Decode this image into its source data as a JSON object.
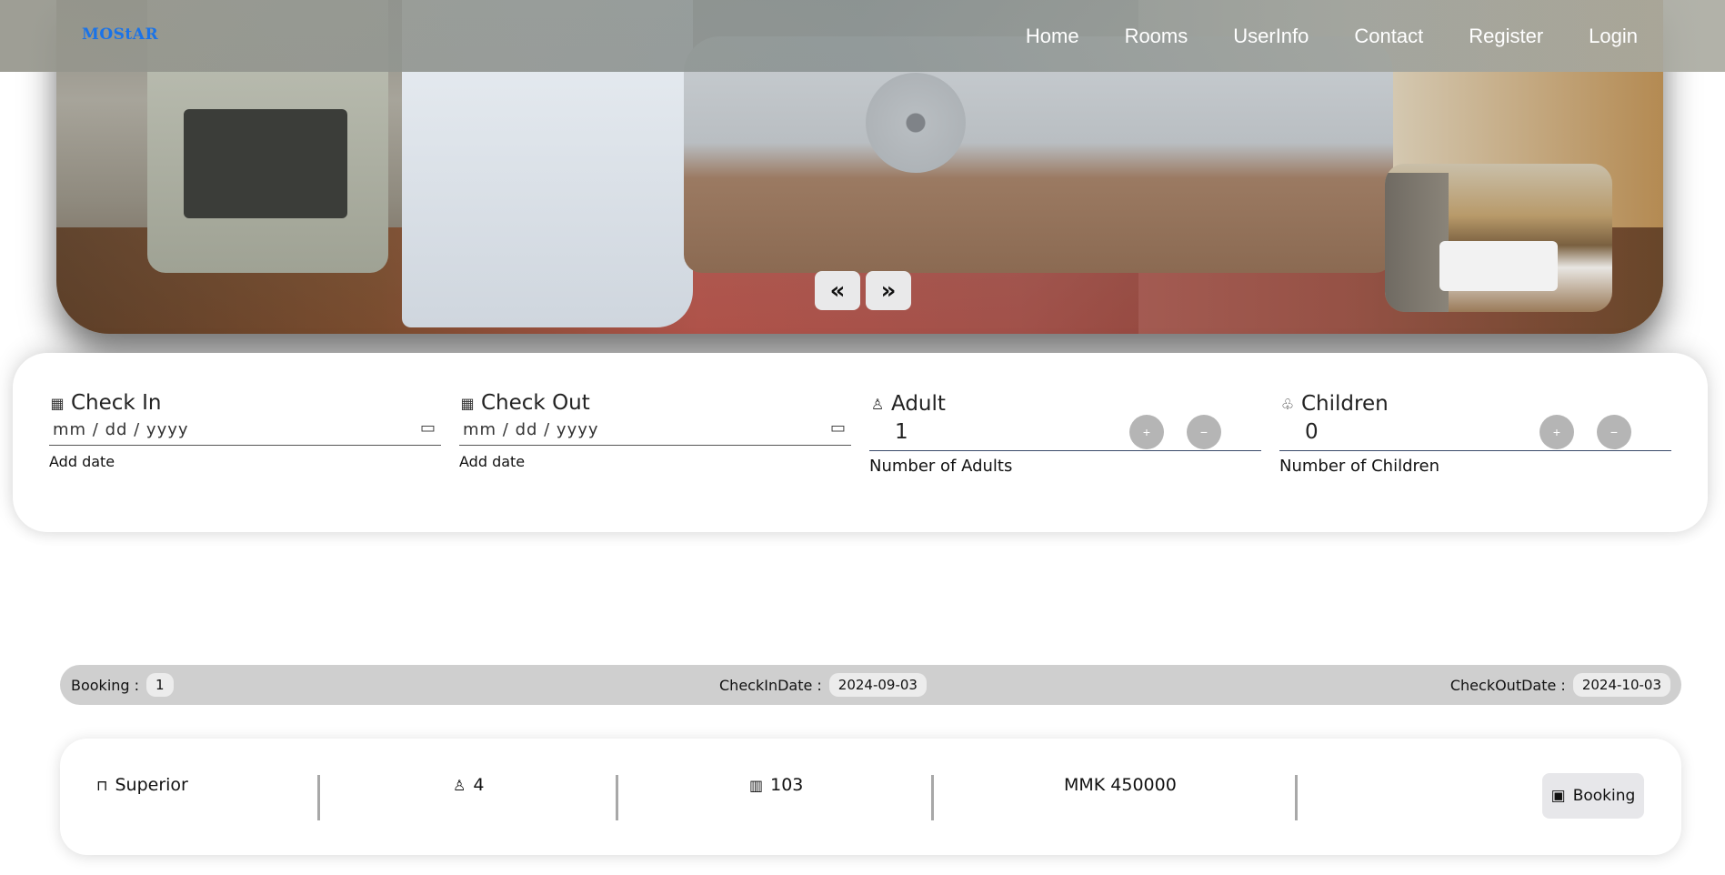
{
  "navbar": {
    "brand": "MOStAR",
    "links": [
      "Home",
      "Rooms",
      "UserInfo",
      "Contact",
      "Register",
      "Login"
    ]
  },
  "hero": {
    "prev_label": "«",
    "next_label": "»"
  },
  "booking_form": {
    "check_in": {
      "label": "Check In",
      "placeholder": "mm / dd / yyyy",
      "hint": "Add date"
    },
    "check_out": {
      "label": "Check Out",
      "placeholder": "mm / dd / yyyy",
      "hint": "Add date"
    },
    "adult": {
      "label": "Adult",
      "value": "1",
      "hint": "Number of Adults",
      "plus": "+",
      "minus": "−"
    },
    "children": {
      "label": "Children",
      "value": "0",
      "hint": "Number of Children",
      "plus": "+",
      "minus": "−"
    }
  },
  "summary": {
    "booking_label": "Booking :",
    "booking_value": "1",
    "checkin_label": "CheckInDate :",
    "checkin_value": "2024-09-03",
    "checkout_label": "CheckOutDate :",
    "checkout_value": "2024-10-03"
  },
  "room": {
    "type": "Superior",
    "guests": "4",
    "room_number": "103",
    "price": "MMK 450000",
    "action_label": "Booking"
  },
  "icons": {
    "calendar": "calendar-icon",
    "person": "person-icon",
    "child": "child-icon",
    "door": "door-icon",
    "bars": "bars-icon",
    "bookmark": "bookmark-icon"
  },
  "colors": {
    "brand": "#1a73e8",
    "summary_bg": "#cfcfcf",
    "button_bg": "#e7e7ea",
    "stepper_bg": "#b5b5b5"
  }
}
